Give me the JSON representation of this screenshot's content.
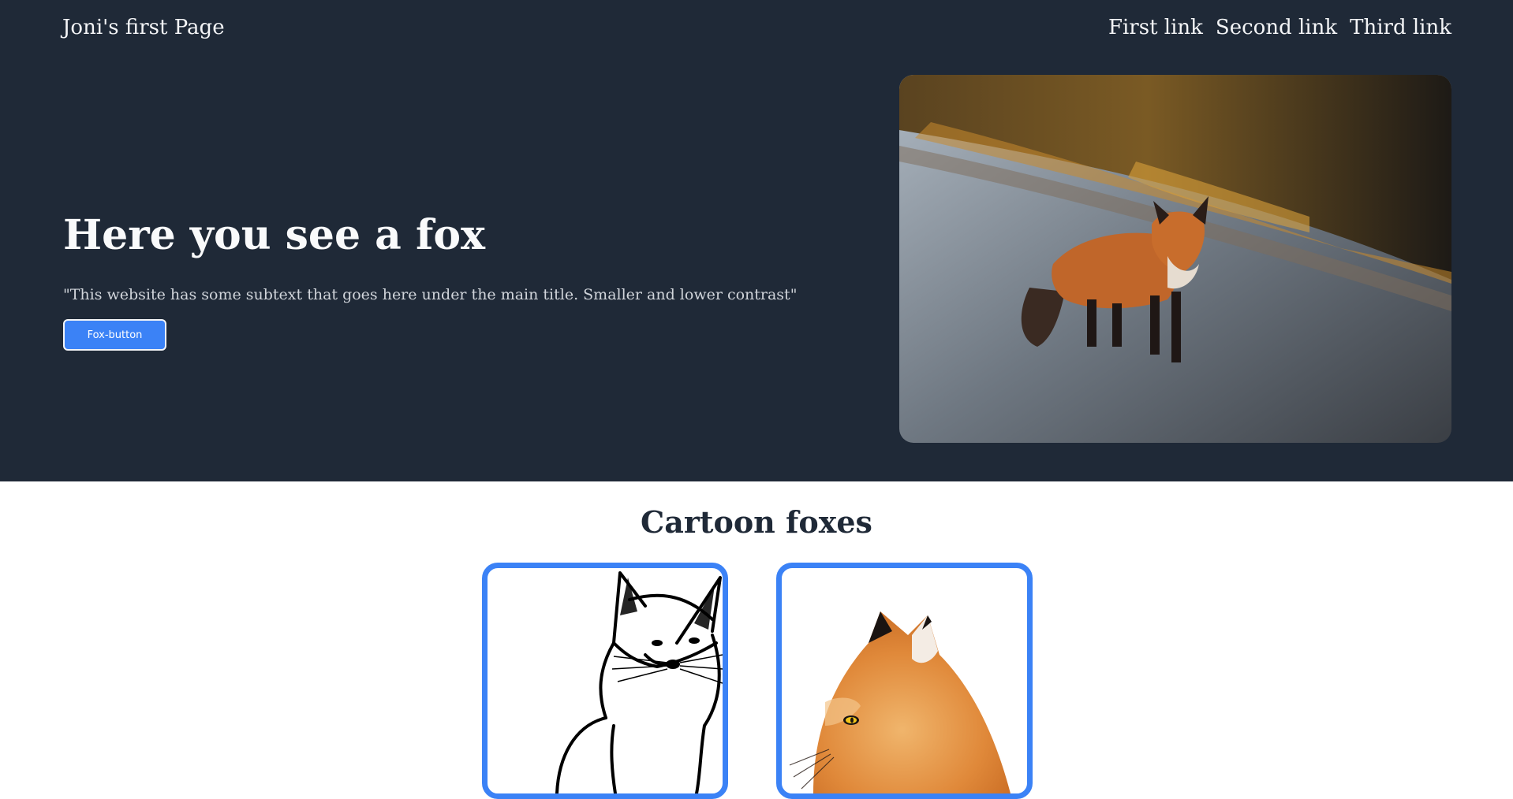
{
  "nav": {
    "brand": "Joni's first Page",
    "links": [
      "First link",
      "Second link",
      "Third link"
    ]
  },
  "hero": {
    "title": "Here you see a fox",
    "subtitle": "\"This website has some subtext that goes here under the main title. Smaller and lower contrast\"",
    "button_label": "Fox-button",
    "image_icon": "fox-photo"
  },
  "section": {
    "title": "Cartoon foxes",
    "cards": [
      "fox-line-drawing",
      "fox-painting"
    ]
  },
  "colors": {
    "hero_bg": "#1f2937",
    "accent": "#3b82f6",
    "text_light": "#f3f4f6"
  }
}
